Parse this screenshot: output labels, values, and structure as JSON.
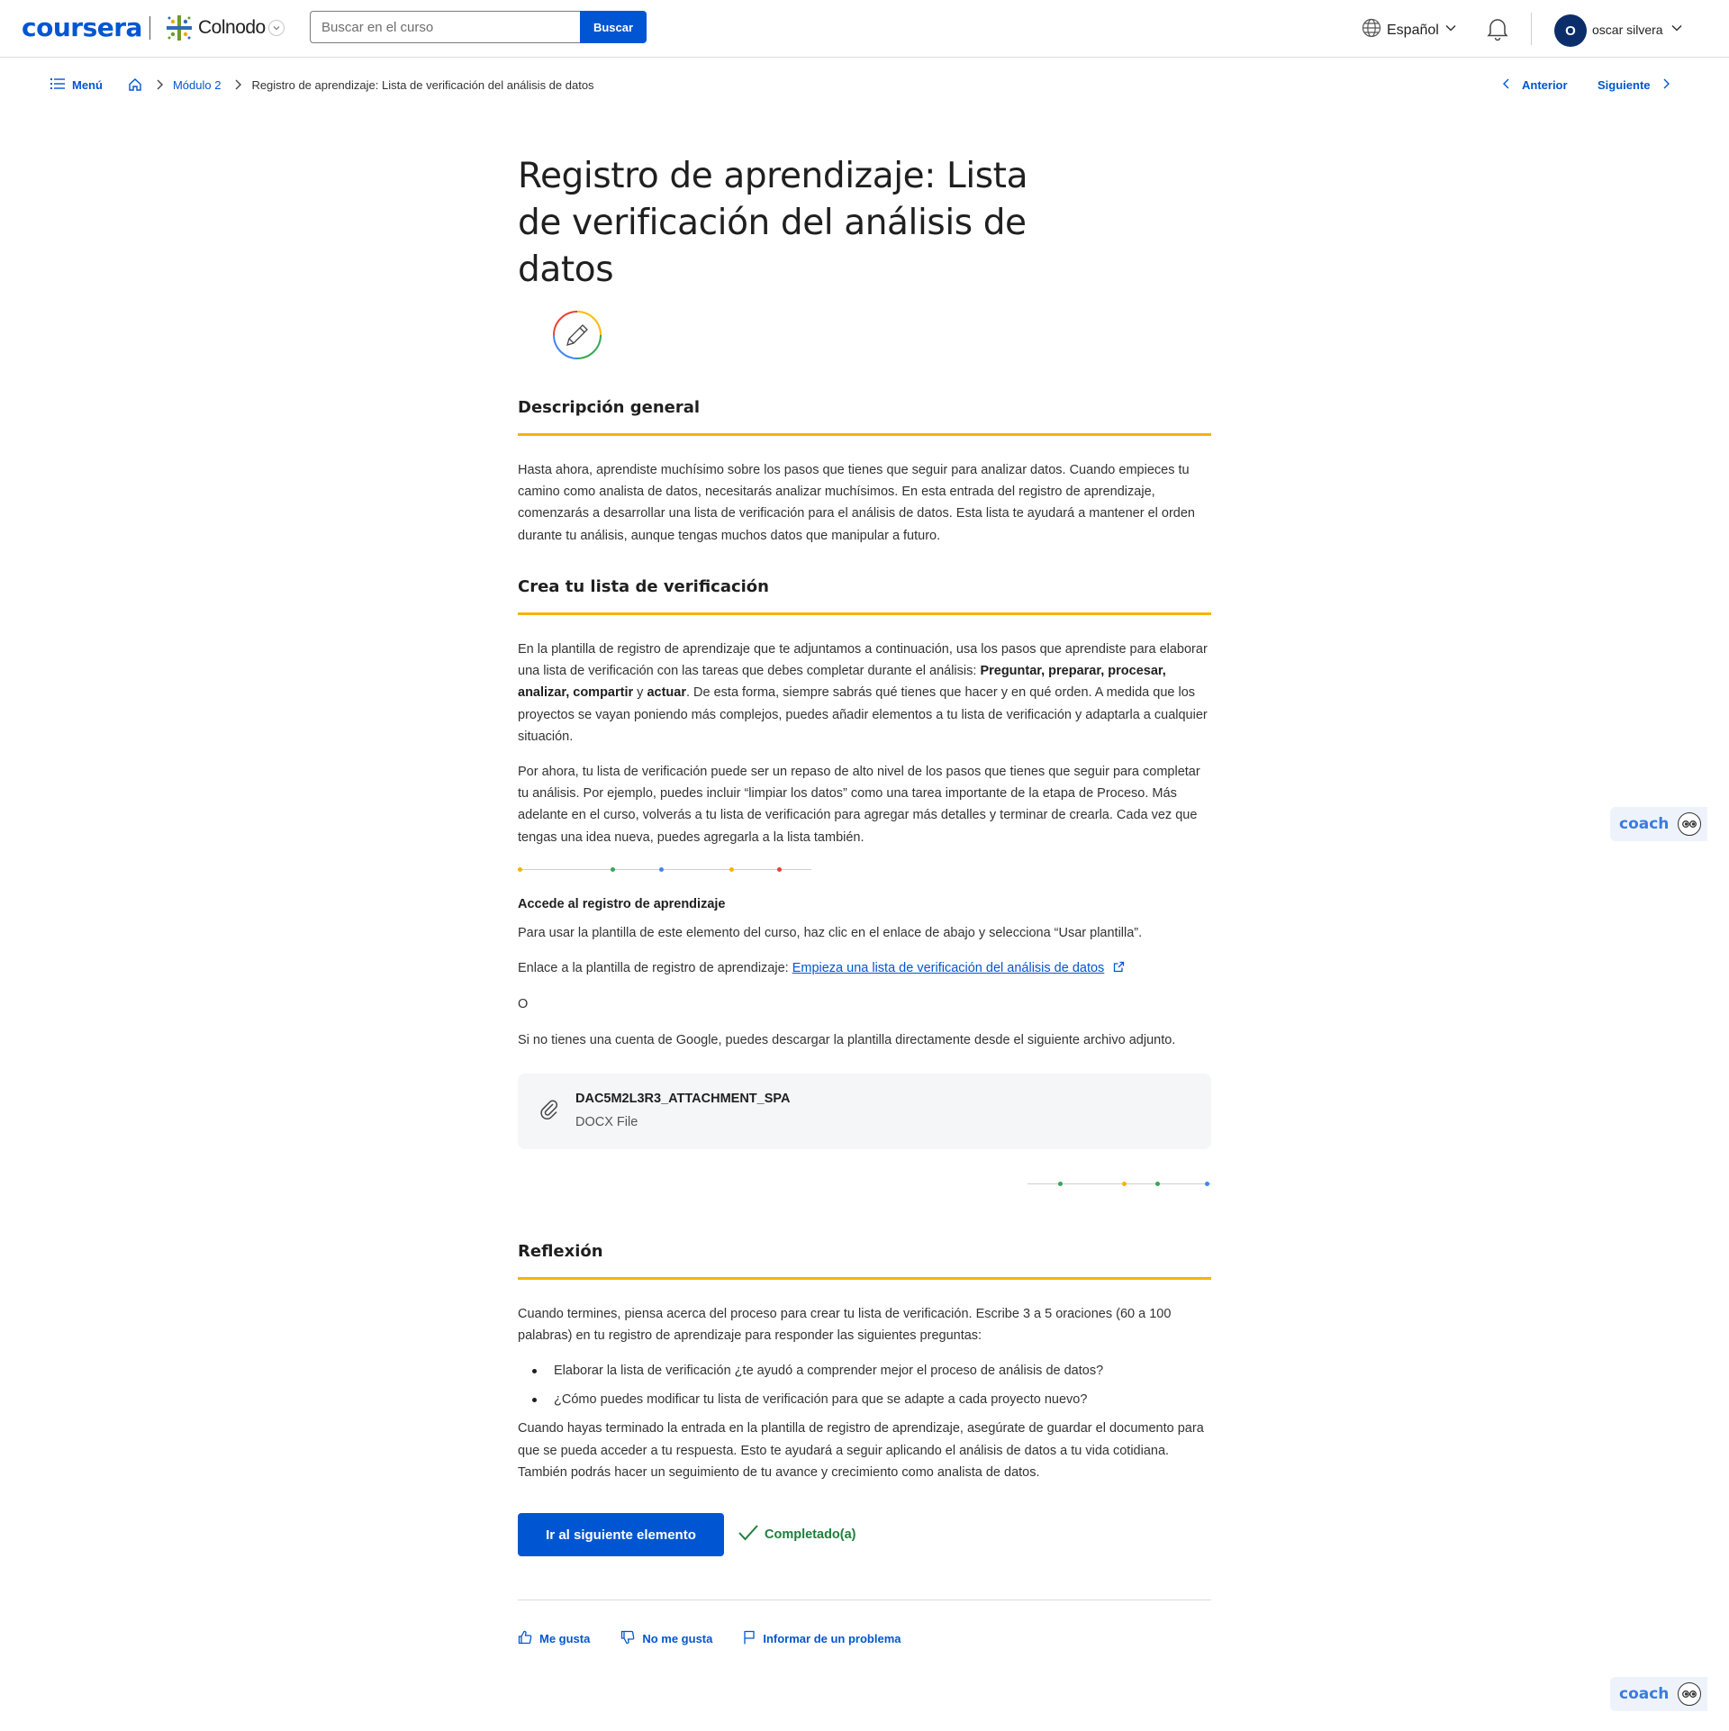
{
  "header": {
    "logo": "coursera",
    "partner_name": "Colnodo",
    "search_placeholder": "Buscar en el curso",
    "search_button": "Buscar",
    "language": "Español",
    "avatar_initial": "O",
    "user_name": "oscar silvera"
  },
  "breadcrumb": {
    "menu_label": "Menú",
    "module_label": "Módulo 2",
    "current_label": "Registro de aprendizaje: Lista de verificación del análisis de datos",
    "prev_label": "Anterior",
    "next_label": "Siguiente"
  },
  "content": {
    "title": "Registro de aprendizaje: Lista de verificación del análisis de datos",
    "overview_heading": "Descripción general",
    "overview_text": "Hasta ahora, aprendiste muchísimo sobre los pasos que tienes que seguir para analizar datos. Cuando empieces tu camino como analista de datos, necesitarás analizar muchísimos. En esta entrada del registro de aprendizaje, comenzarás a desarrollar una lista de verificación para el análisis de datos. Esta lista te ayudará a mantener el orden durante tu análisis, aunque tengas muchos datos que manipular a futuro.",
    "create_heading": "Crea tu lista de verificación",
    "create_p1_a": "En la plantilla de registro de aprendizaje que te adjuntamos a continuación, usa los pasos que aprendiste para elaborar una lista de verificación con las tareas que debes completar durante el análisis: ",
    "create_p1_b": "Preguntar, preparar, procesar, analizar, compartir",
    "create_p1_c": " y ",
    "create_p1_d": "actuar",
    "create_p1_e": ". De esta forma, siempre sabrás qué tienes que hacer y en qué orden. A medida que los proyectos se vayan poniendo más complejos, puedes añadir elementos a tu lista de verificación y adaptarla a cualquier situación.",
    "create_p2": "Por ahora, tu lista de verificación puede ser un repaso de alto nivel de los pasos que tienes que seguir para completar tu análisis. Por ejemplo, puedes incluir “limpiar los datos” como una tarea importante de la etapa de Proceso. Más adelante en el curso, volverás a tu lista de verificación para agregar más detalles y terminar de crearla. Cada vez que tengas una idea nueva, puedes agregarla a la lista también.",
    "access_heading": "Accede al registro de aprendizaje",
    "access_p1": "Para usar la plantilla de este elemento del curso, haz clic en el enlace de abajo y selecciona “Usar plantilla”.",
    "access_link_prefix": "Enlace a la plantilla de registro de aprendizaje: ",
    "access_link_text": "Empieza una lista de verificación del análisis de datos",
    "or_text": "O",
    "download_text": "Si no tienes una cuenta de Google, puedes descargar la plantilla directamente desde el siguiente archivo adjunto.",
    "attachment_name": "DAC5M2L3R3_ATTACHMENT_SPA",
    "attachment_type": "DOCX File",
    "reflection_heading": "Reflexión",
    "reflection_p1": "Cuando termines, piensa acerca del proceso para crear tu lista de verificación. Escribe 3 a 5 oraciones (60 a 100 palabras) en tu registro de aprendizaje para responder las siguientes preguntas:",
    "reflection_bullets": [
      "Elaborar la lista de verificación ¿te ayudó a comprender mejor el proceso de análisis de datos?",
      "¿Cómo puedes modificar tu lista de verificación para que se adapte a cada proyecto nuevo?"
    ],
    "reflection_p2": "Cuando hayas terminado la entrada en la plantilla de registro de aprendizaje, asegúrate de guardar el documento para que se pueda acceder a tu respuesta. Esto te ayudará a seguir aplicando el análisis de datos a tu vida cotidiana. También podrás hacer un seguimiento de tu avance y crecimiento como analista de datos.",
    "next_button": "Ir al siguiente elemento",
    "completed_label": "Completado(a)"
  },
  "feedback": {
    "like": "Me gusta",
    "dislike": "No me gusta",
    "report": "Informar de un problema"
  },
  "coach_label": "coach",
  "colors": {
    "primary": "#0056d2",
    "heading_rule": "#f4b400",
    "completed": "#1e7f3a"
  }
}
